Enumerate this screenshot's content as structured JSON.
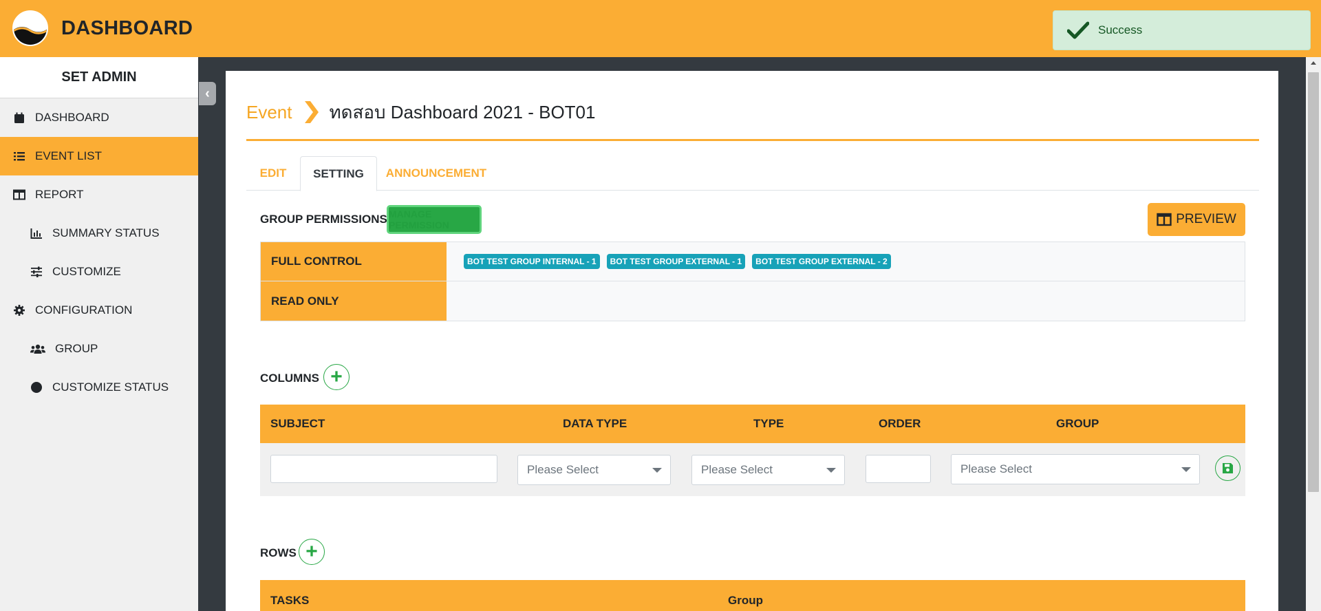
{
  "app": {
    "title": "DASHBOARD"
  },
  "toast": {
    "message": "Success"
  },
  "sidebar": {
    "header": "SET ADMIN",
    "items": [
      {
        "label": "DASHBOARD",
        "icon": "calendar-icon"
      },
      {
        "label": "EVENT LIST",
        "icon": "list-icon",
        "active": true
      },
      {
        "label": "REPORT",
        "icon": "table-icon"
      },
      {
        "label": "SUMMARY STATUS",
        "icon": "chart-bar-icon"
      },
      {
        "label": "CUSTOMIZE",
        "icon": "sliders-icon"
      },
      {
        "label": "CONFIGURATION",
        "icon": "gear-icon"
      },
      {
        "label": "GROUP",
        "icon": "users-icon"
      },
      {
        "label": "CUSTOMIZE STATUS",
        "icon": "circle-icon"
      }
    ]
  },
  "breadcrumb": {
    "parent": "Event",
    "current": "ทดสอบ Dashboard 2021 - BOT01"
  },
  "tabs": [
    {
      "label": "EDIT"
    },
    {
      "label": "SETTING",
      "active": true
    },
    {
      "label": "ANNOUNCEMENT"
    }
  ],
  "permissions": {
    "title": "GROUP PERMISSIONS",
    "manage_label": "MANAGE PERMISSION",
    "preview_label": "PREVIEW",
    "rows": [
      {
        "label": "FULL CONTROL",
        "badges": [
          "BOT TEST GROUP INTERNAL - 1",
          "BOT TEST GROUP EXTERNAL - 1",
          "BOT TEST GROUP EXTERNAL - 2"
        ]
      },
      {
        "label": "READ ONLY",
        "badges": []
      }
    ]
  },
  "columns": {
    "title": "COLUMNS",
    "headers": {
      "subject": "SUBJECT",
      "data_type": "DATA TYPE",
      "type": "TYPE",
      "order": "ORDER",
      "group": "GROUP"
    },
    "form": {
      "subject_value": "",
      "data_type_value": "Please Select",
      "type_value": "Please Select",
      "order_value": "",
      "group_value": "Please Select"
    }
  },
  "rows": {
    "title": "ROWS",
    "headers": {
      "tasks": "TASKS",
      "group": "Group"
    }
  },
  "colors": {
    "accent": "#fbad34",
    "success": "#28a745",
    "badge": "#17a2b8"
  }
}
